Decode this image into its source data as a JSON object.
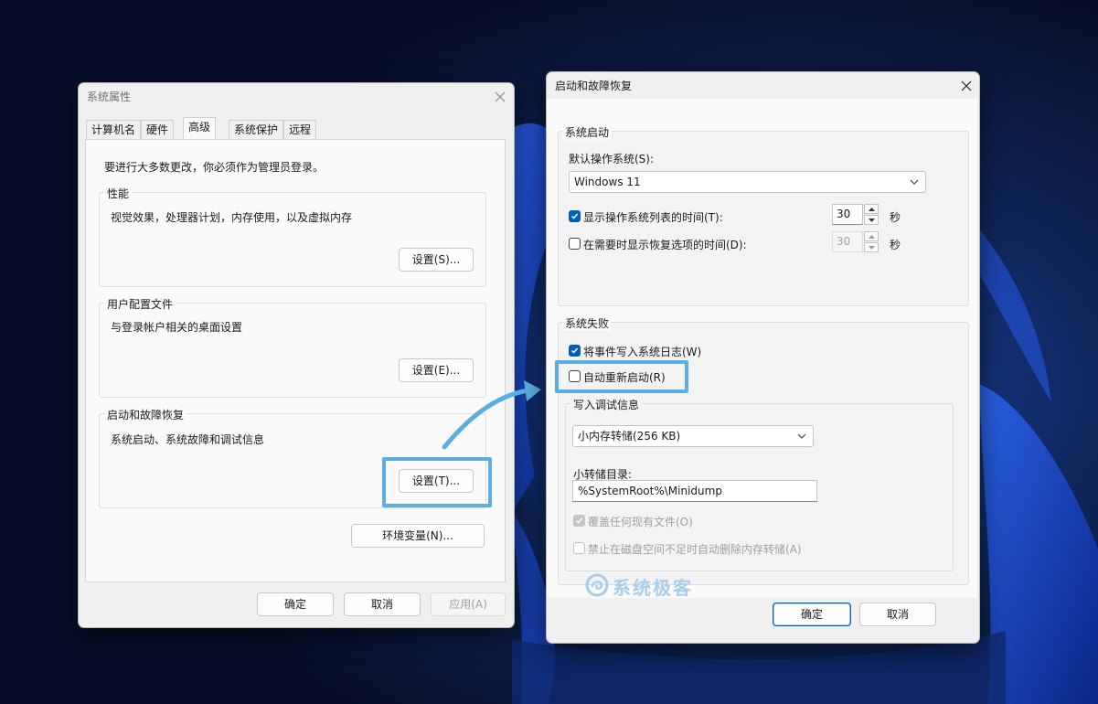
{
  "sys_props": {
    "title": "系统属性",
    "tabs": [
      {
        "label": "计算机名"
      },
      {
        "label": "硬件"
      },
      {
        "label": "高级"
      },
      {
        "label": "系统保护"
      },
      {
        "label": "远程"
      }
    ],
    "admin_notice": "要进行大多数更改，你必须作为管理员登录。",
    "performance": {
      "label": "性能",
      "description": "视觉效果，处理器计划，内存使用，以及虚拟内存",
      "button": "设置(S)..."
    },
    "user_profiles": {
      "label": "用户配置文件",
      "description": "与登录帐户相关的桌面设置",
      "button": "设置(E)..."
    },
    "startup_recovery": {
      "label": "启动和故障恢复",
      "description": "系统启动、系统故障和调试信息",
      "button": "设置(T)..."
    },
    "env_button": "环境变量(N)...",
    "ok": "确定",
    "cancel": "取消",
    "apply": "应用(A)"
  },
  "startup_dialog": {
    "title": "启动和故障恢复",
    "system_startup": {
      "label": "系统启动",
      "default_os_label": "默认操作系统(S):",
      "default_os_value": "Windows 11",
      "show_list_label": "显示操作系统列表的时间(T):",
      "show_list_checked": true,
      "show_list_value": "30",
      "show_recovery_label": "在需要时显示恢复选项的时间(D):",
      "show_recovery_checked": false,
      "show_recovery_value": "30",
      "seconds_unit": "秒"
    },
    "system_failure": {
      "label": "系统失败",
      "write_event_label": "将事件写入系统日志(W)",
      "write_event_checked": true,
      "auto_restart_label": "自动重新启动(R)",
      "auto_restart_checked": false,
      "debug_info": {
        "label": "写入调试信息",
        "dump_type": "小内存转储(256 KB)",
        "dump_dir_label": "小转储目录:",
        "dump_dir_value": "%SystemRoot%\\Minidump",
        "overwrite_label": "覆盖任何现有文件(O)",
        "overwrite_checked": true,
        "disable_auto_delete_label": "禁止在磁盘空间不足时自动删除内存转储(A)",
        "disable_auto_delete_checked": false
      }
    },
    "ok": "确定",
    "cancel": "取消"
  },
  "watermark": {
    "text": "系统极客",
    "icon": "sysgeek-logo-icon"
  },
  "colors": {
    "accent": "#005fb8",
    "highlight": "#5aaee0",
    "wallpaper": "#0a1838"
  }
}
